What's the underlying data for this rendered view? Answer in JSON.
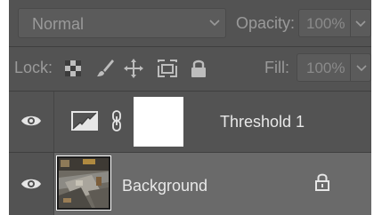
{
  "blend_mode": {
    "value": "Normal",
    "options_visible": [
      "Normal"
    ]
  },
  "opacity": {
    "label": "Opacity:",
    "value": "100%"
  },
  "lock": {
    "label": "Lock:",
    "icons": [
      "lock-transparent-pixels-icon",
      "lock-image-pixels-icon",
      "lock-position-icon",
      "prevent-auto-nesting-icon",
      "lock-all-icon"
    ]
  },
  "fill": {
    "label": "Fill:",
    "value": "100%"
  },
  "layers": [
    {
      "name": "Threshold 1",
      "type": "adjustment",
      "adjustment_icon": "threshold-adjustment-icon",
      "visible": true,
      "selected": false,
      "linked_mask": true
    },
    {
      "name": "Background",
      "type": "image",
      "visible": true,
      "selected": true,
      "locked": true
    }
  ],
  "colors": {
    "panel_bg": "#535353",
    "selected_row": "#6a6a6a",
    "text_dim": "#9a9a9a",
    "text_bright": "#e8e8e8"
  }
}
